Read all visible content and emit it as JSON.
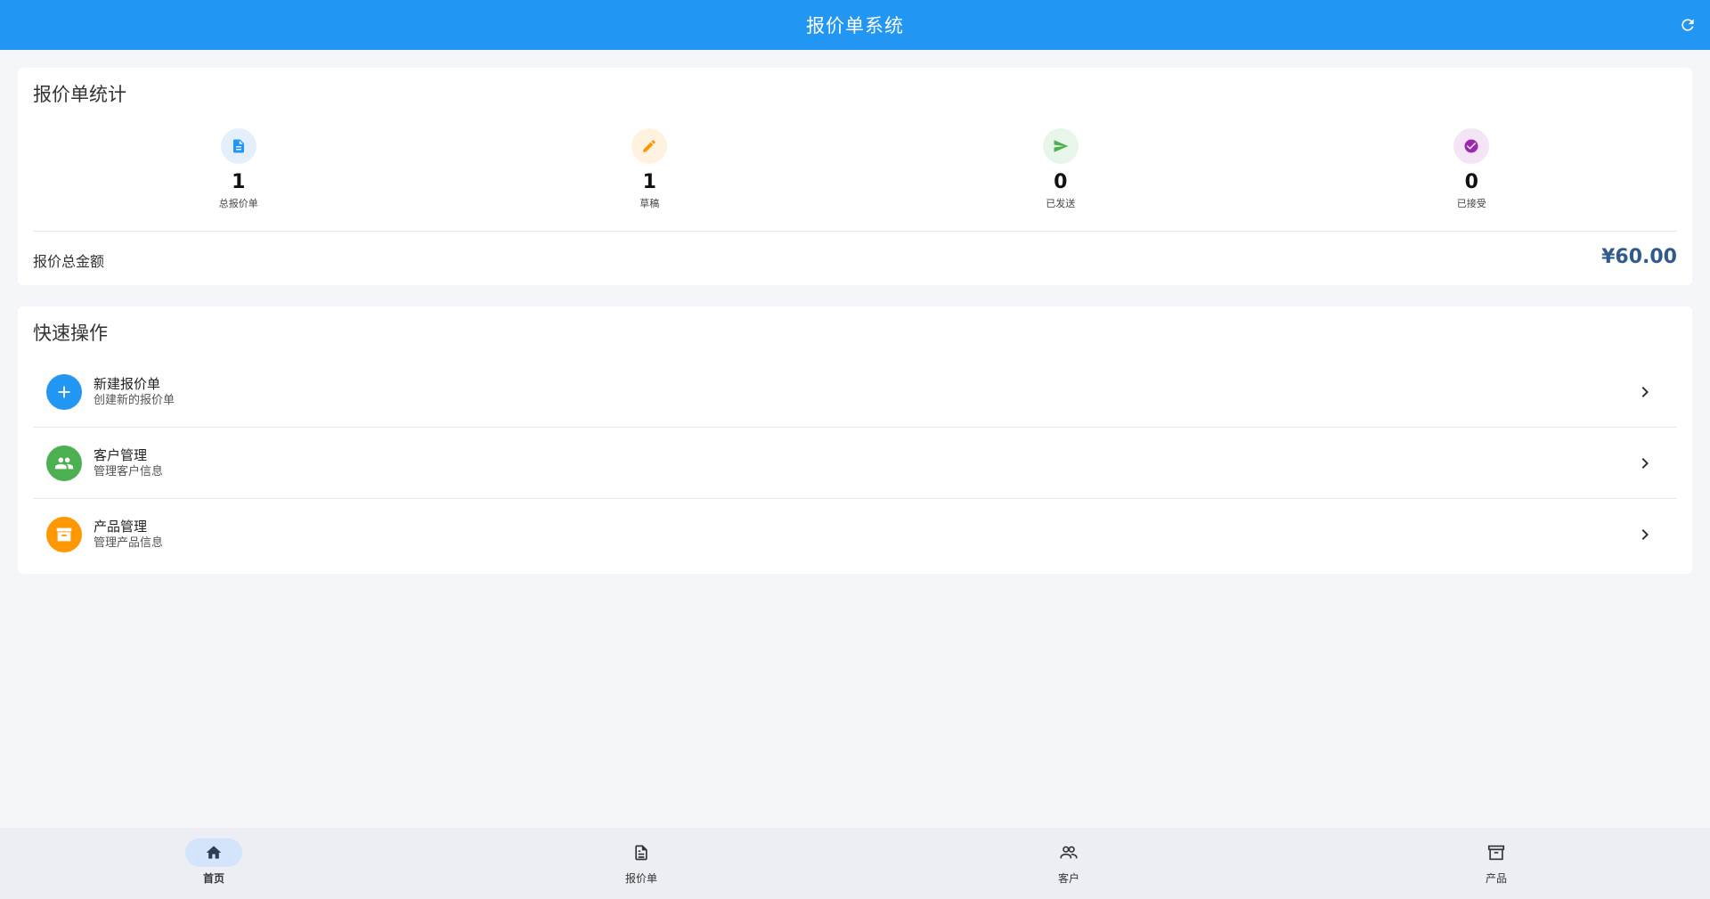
{
  "appbar": {
    "title": "报价单系统"
  },
  "stats": {
    "title": "报价单统计",
    "items": [
      {
        "value": "1",
        "label": "总报价单",
        "icon": "document-icon",
        "color": "#2196f3",
        "bg": "#e3f0fc"
      },
      {
        "value": "1",
        "label": "草稿",
        "icon": "pencil-icon",
        "color": "#ff9800",
        "bg": "#fff2e0"
      },
      {
        "value": "0",
        "label": "已发送",
        "icon": "send-icon",
        "color": "#4caf50",
        "bg": "#e8f5e9"
      },
      {
        "value": "0",
        "label": "已接受",
        "icon": "check-circle-icon",
        "color": "#9c27b0",
        "bg": "#f3e5f5"
      }
    ],
    "total_label": "报价总金额",
    "total_amount": "¥60.00"
  },
  "actions": {
    "title": "快速操作",
    "items": [
      {
        "title": "新建报价单",
        "subtitle": "创建新的报价单",
        "icon": "plus-icon",
        "color": "#2196f3"
      },
      {
        "title": "客户管理",
        "subtitle": "管理客户信息",
        "icon": "people-icon",
        "color": "#4caf50"
      },
      {
        "title": "产品管理",
        "subtitle": "管理产品信息",
        "icon": "archive-icon",
        "color": "#ff9800"
      }
    ]
  },
  "nav": {
    "items": [
      {
        "label": "首页",
        "icon": "home-icon",
        "active": true
      },
      {
        "label": "报价单",
        "icon": "document-outline-icon",
        "active": false
      },
      {
        "label": "客户",
        "icon": "people-outline-icon",
        "active": false
      },
      {
        "label": "产品",
        "icon": "archive-outline-icon",
        "active": false
      }
    ]
  }
}
